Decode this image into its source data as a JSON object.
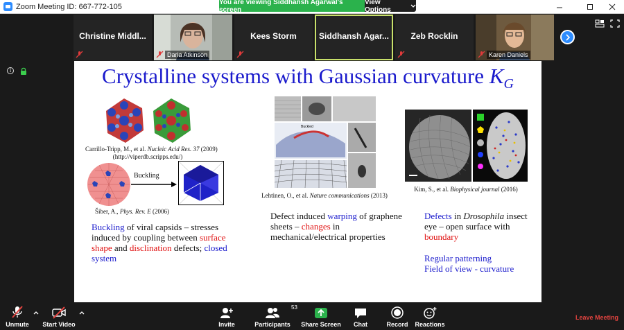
{
  "window": {
    "title": "Zoom Meeting ID: 667-772-105"
  },
  "banner": {
    "viewing_text": "You are viewing Siddhansh Agarwal's screen",
    "options_label": "View Options"
  },
  "participants": [
    {
      "name": "Christine  Middl...",
      "has_video": false
    },
    {
      "name": "Daria Atkinson",
      "has_video": true
    },
    {
      "name": "Kees Storm",
      "has_video": false
    },
    {
      "name": "Siddhansh  Agar...",
      "has_video": false,
      "active": true
    },
    {
      "name": "Zeb Rocklin",
      "has_video": false
    },
    {
      "name": "Karen Daniels",
      "has_video": true
    }
  ],
  "slide": {
    "title_main": "Crystalline systems with Gaussian curvature ",
    "title_symbol": "K",
    "title_sub": "G",
    "left": {
      "cap1_authors": "Carrillo-Tripp, M., et al. ",
      "cap1_journal": "Nucleic Acid Res. 37",
      "cap1_year": " (2009)",
      "cap1_url": "(http://viperdb.scripps.edu/)",
      "buckling_label": "Buckling",
      "cap2_author": "Šiber, A., ",
      "cap2_journal": "Phys. Rev. E",
      "cap2_year": " (2006)",
      "text_1": "Buckling",
      "text_2": " of viral capsids – stresses induced by coupling between ",
      "text_3": "surface shape",
      "text_4": " and ",
      "text_5": "disclination",
      "text_6": " defects; ",
      "text_7": "closed system"
    },
    "middle": {
      "inner_label": "Buckled",
      "cap_authors": "Lehtinen, O., et al. ",
      "cap_journal": "Nature communications",
      "cap_year": " (2013)",
      "text_1": "Defect induced ",
      "text_2": "warping",
      "text_3": " of graphene sheets – ",
      "text_4": "changes",
      "text_5": " in mechanical/electrical properties"
    },
    "right": {
      "cap_authors": "Kim, S., et al. ",
      "cap_journal": "Biophysical journal",
      "cap_year": " (2016)",
      "text_1": "Defects",
      "text_2": " in ",
      "text_3": "Drosophila",
      "text_4": " insect eye – open surface with ",
      "text_5": "boundary",
      "text_6": "Regular patterning",
      "text_7": "Field of view - curvature"
    }
  },
  "toolbar": {
    "unmute": "Unmute",
    "start_video": "Start Video",
    "invite": "Invite",
    "participants": "Participants",
    "participants_count": "53",
    "share_screen": "Share Screen",
    "chat": "Chat",
    "record": "Record",
    "reactions": "Reactions",
    "leave": "Leave Meeting"
  },
  "colors": {
    "zoom_blue": "#2d8cff",
    "banner_green": "#2bb24c",
    "slide_blue": "#1a1acc",
    "slide_red": "#e01010",
    "leave_red": "#e0433f"
  },
  "icons": [
    "zoom-icon",
    "minimize-icon",
    "maximize-icon",
    "close-icon",
    "gallery-view-icon",
    "fullscreen-icon",
    "chevron-right-icon",
    "info-icon",
    "lock-icon",
    "microphone-muted-icon",
    "video-off-icon",
    "invite-icon",
    "participants-icon",
    "share-screen-icon",
    "chat-icon",
    "record-icon",
    "reactions-icon"
  ]
}
